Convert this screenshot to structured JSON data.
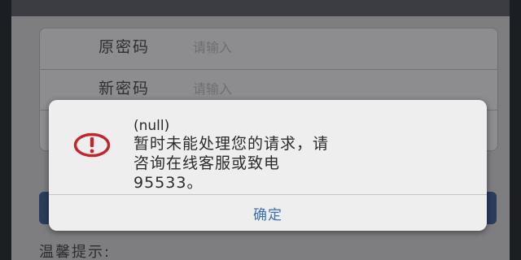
{
  "form": {
    "old_password_label": "原密码",
    "old_password_placeholder": "请输入",
    "new_password_label": "新密码",
    "new_password_placeholder": "请输入"
  },
  "tips_label": "温馨提示:",
  "dialog": {
    "icon": "exclamation-circle-icon",
    "title": "(null)",
    "message_line1": "暂时未能处理您的请求，请",
    "message_line2": "咨询在线客服或致电",
    "message_line3": "95533。",
    "ok_label": "确定",
    "icon_color": "#c0272d",
    "ok_color": "#3e6fb0"
  }
}
